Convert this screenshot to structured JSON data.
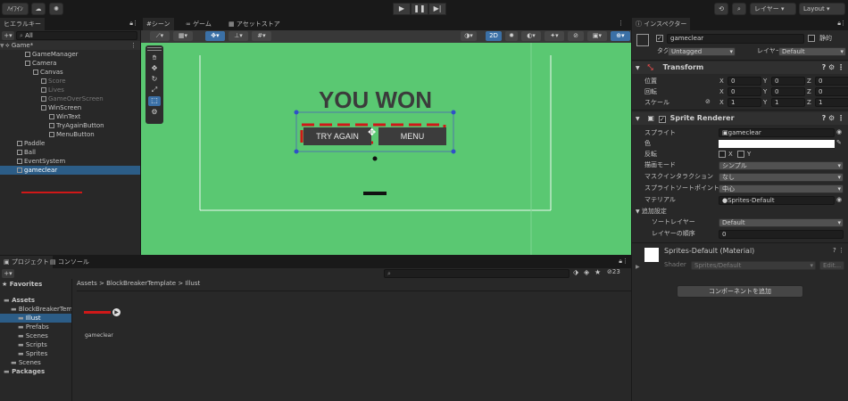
{
  "toolbar": {
    "account_label": "ﾊｲﾌｲﾝ",
    "layer_label": "レイヤー",
    "layout_label": "Layout"
  },
  "hierarchy": {
    "tab_label": "ヒエラルキー",
    "search_placeholder": "All",
    "scene_name": "Game*",
    "rows": [
      {
        "label": "GameManager",
        "indent": 2,
        "dim": false
      },
      {
        "label": "Camera",
        "indent": 2,
        "dim": false
      },
      {
        "label": "Canvas",
        "indent": 3,
        "dim": false
      },
      {
        "label": "Score",
        "indent": 4,
        "dim": true
      },
      {
        "label": "Lives",
        "indent": 4,
        "dim": true
      },
      {
        "label": "GameOverScreen",
        "indent": 4,
        "dim": true
      },
      {
        "label": "WinScreen",
        "indent": 4,
        "dim": false
      },
      {
        "label": "WinText",
        "indent": 5,
        "dim": false
      },
      {
        "label": "TryAgainButton",
        "indent": 5,
        "dim": false
      },
      {
        "label": "MenuButton",
        "indent": 5,
        "dim": false
      },
      {
        "label": "Paddle",
        "indent": 1,
        "dim": false
      },
      {
        "label": "Ball",
        "indent": 1,
        "dim": false
      },
      {
        "label": "EventSystem",
        "indent": 1,
        "dim": false
      },
      {
        "label": "gameclear",
        "indent": 1,
        "dim": false,
        "selected": true
      }
    ]
  },
  "scene": {
    "tabs": [
      "シーン",
      "ゲーム",
      "アセットストア"
    ],
    "mode_2d": "2D",
    "win_text": "YOU WON",
    "try_again": "TRY AGAIN",
    "menu": "MENU"
  },
  "project": {
    "tabs": [
      "プロジェクト",
      "コンソール"
    ],
    "favorites_label": "Favorites",
    "tree": [
      {
        "label": "Assets",
        "indent": 0,
        "bold": true
      },
      {
        "label": "BlockBreakerTem",
        "indent": 1
      },
      {
        "label": "Illust",
        "indent": 2,
        "selected": true
      },
      {
        "label": "Prefabs",
        "indent": 2
      },
      {
        "label": "Scenes",
        "indent": 2
      },
      {
        "label": "Scripts",
        "indent": 2
      },
      {
        "label": "Sprites",
        "indent": 2
      },
      {
        "label": "Scenes",
        "indent": 1
      },
      {
        "label": "Packages",
        "indent": 0,
        "bold": true
      }
    ],
    "breadcrumb": [
      "Assets",
      "BlockBreakerTemplate",
      "Illust"
    ],
    "asset_name": "gameclear",
    "count": "23"
  },
  "inspector": {
    "tab_label": "インスペクター",
    "object_name": "gameclear",
    "static_label": "静的",
    "tag_label": "タグ",
    "tag_value": "Untagged",
    "layer_label": "レイヤー",
    "layer_value": "Default",
    "transform": {
      "title": "Transform",
      "position_label": "位置",
      "rotation_label": "回転",
      "scale_label": "スケール",
      "position": [
        "0",
        "0",
        "0"
      ],
      "rotation": [
        "0",
        "0",
        "0"
      ],
      "scale": [
        "1",
        "1",
        "1"
      ]
    },
    "sprite_renderer": {
      "title": "Sprite Renderer",
      "sprite_label": "スプライト",
      "sprite_value": "gameclear",
      "color_label": "色",
      "flip_label": "反転",
      "draw_mode_label": "描画モード",
      "draw_mode_value": "シンプル",
      "mask_label": "マスクインタラクション",
      "mask_value": "なし",
      "pivot_label": "スプライトソートポイント",
      "pivot_value": "中心",
      "material_label": "マテリアル",
      "material_value": "Sprites-Default",
      "additional_label": "追加設定",
      "sorting_label": "ソートレイヤー",
      "sorting_value": "Default",
      "order_label": "レイヤーの順序",
      "order_value": "0"
    },
    "material_name": "Sprites-Default (Material)",
    "shader_label": "Shader",
    "shader_value": "Sprites/Default",
    "edit_label": "Edit...",
    "add_component": "コンポーネントを追加"
  },
  "colors": {
    "scene_bg": "#5ac872",
    "selection": "#2c5d87",
    "accent_red": "#d01818"
  }
}
